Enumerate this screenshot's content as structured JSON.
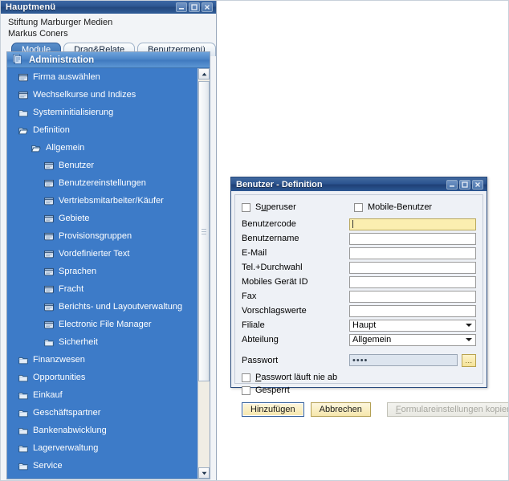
{
  "main_window": {
    "title": "Hauptmenü",
    "controls": [
      {
        "name": "minimize",
        "glyph": "minimize-icon"
      },
      {
        "name": "maximize",
        "glyph": "maximize-icon"
      },
      {
        "name": "close",
        "glyph": "close-icon"
      }
    ],
    "organization": "Stiftung Marburger Medien",
    "user": "Markus Coners",
    "tabs": [
      {
        "label": "Module",
        "mnemonic": "o",
        "active": true
      },
      {
        "label": "Drag&Relate",
        "mnemonic": "a",
        "active": false
      },
      {
        "label": "Benutzermenü",
        "mnemonic": "u",
        "active": false
      }
    ],
    "tree_header": {
      "label": "Administration",
      "icon": "module-icon"
    },
    "tree_items": [
      {
        "label": "Firma auswählen",
        "level": 1,
        "icon": "window-icon"
      },
      {
        "label": "Wechselkurse und Indizes",
        "level": 1,
        "icon": "window-icon"
      },
      {
        "label": "Systeminitialisierung",
        "level": 1,
        "icon": "folder-icon"
      },
      {
        "label": "Definition",
        "level": 1,
        "icon": "folder-open-icon"
      },
      {
        "label": "Allgemein",
        "level": 2,
        "icon": "folder-open-icon"
      },
      {
        "label": "Benutzer",
        "level": 3,
        "icon": "window-icon"
      },
      {
        "label": "Benutzereinstellungen",
        "level": 3,
        "icon": "window-icon"
      },
      {
        "label": "Vertriebsmitarbeiter/Käufer",
        "level": 3,
        "icon": "window-icon"
      },
      {
        "label": "Gebiete",
        "level": 3,
        "icon": "window-icon"
      },
      {
        "label": "Provisionsgruppen",
        "level": 3,
        "icon": "window-icon"
      },
      {
        "label": "Vordefinierter Text",
        "level": 3,
        "icon": "window-icon"
      },
      {
        "label": "Sprachen",
        "level": 3,
        "icon": "window-icon"
      },
      {
        "label": "Fracht",
        "level": 3,
        "icon": "window-icon"
      },
      {
        "label": "Berichts- und Layoutverwaltung",
        "level": 3,
        "icon": "window-icon"
      },
      {
        "label": "Electronic File Manager",
        "level": 3,
        "icon": "window-icon"
      },
      {
        "label": "Sicherheit",
        "level": 3,
        "icon": "folder-icon"
      },
      {
        "label": "Finanzwesen",
        "level": 1,
        "icon": "folder-icon"
      },
      {
        "label": "Opportunities",
        "level": 1,
        "icon": "folder-icon"
      },
      {
        "label": "Einkauf",
        "level": 1,
        "icon": "folder-icon"
      },
      {
        "label": "Geschäftspartner",
        "level": 1,
        "icon": "folder-icon"
      },
      {
        "label": "Bankenabwicklung",
        "level": 1,
        "icon": "folder-icon"
      },
      {
        "label": "Lagerverwaltung",
        "level": 1,
        "icon": "folder-icon"
      },
      {
        "label": "Service",
        "level": 1,
        "icon": "folder-icon"
      }
    ]
  },
  "dialog": {
    "title": "Benutzer - Definition",
    "checkboxes_top": [
      {
        "label": "Superuser",
        "checked": false,
        "mnemonic": "u"
      },
      {
        "label": "Mobile-Benutzer",
        "checked": false
      }
    ],
    "fields": [
      {
        "label": "Benutzercode",
        "value": "",
        "type": "text",
        "required": true
      },
      {
        "label": "Benutzername",
        "value": "",
        "type": "text"
      },
      {
        "label": "E-Mail",
        "value": "",
        "type": "text"
      },
      {
        "label": "Tel.+Durchwahl",
        "value": "",
        "type": "text"
      },
      {
        "label": "Mobiles Gerät ID",
        "value": "",
        "type": "text"
      },
      {
        "label": "Fax",
        "value": "",
        "type": "text"
      },
      {
        "label": "Vorschlagswerte",
        "value": "",
        "type": "text"
      },
      {
        "label": "Filiale",
        "value": "Haupt",
        "type": "select"
      },
      {
        "label": "Abteilung",
        "value": "Allgemein",
        "type": "select"
      }
    ],
    "password": {
      "label": "Passwort",
      "value": "••••",
      "browse_label": "..."
    },
    "checkboxes_bottom": [
      {
        "label": "Passwort läuft nie ab",
        "checked": false,
        "mnemonic": "P"
      },
      {
        "label": "Gesperrt",
        "checked": false
      }
    ],
    "buttons": [
      {
        "label": "Hinzufügen",
        "style": "default",
        "enabled": true
      },
      {
        "label": "Abbrechen",
        "style": "normal",
        "enabled": true
      },
      {
        "label": "Formulareinstellungen kopieren",
        "style": "disabled",
        "enabled": false
      }
    ],
    "controls": [
      {
        "name": "minimize",
        "glyph": "minimize-icon"
      },
      {
        "name": "maximize",
        "glyph": "maximize-icon"
      },
      {
        "name": "close",
        "glyph": "close-icon"
      }
    ]
  },
  "colors": {
    "titlebar": "#2d5793",
    "tree_blue": "#3d7bc8",
    "required_field": "#fbeeb0",
    "button": "#f6e7ac",
    "accent": "#4a83c6"
  }
}
